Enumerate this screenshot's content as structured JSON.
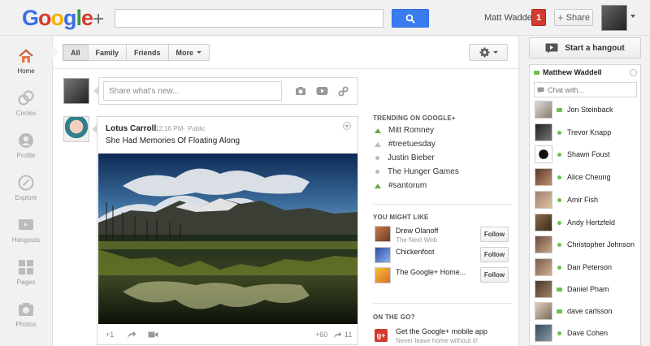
{
  "app": {
    "logo_text": "Google",
    "logo_plus": "+",
    "user_name": "Matt Waddell",
    "notification_count": "1",
    "share_label": "Share",
    "search_placeholder": "",
    "colors": {
      "accent_blue": "#3a7cf0",
      "notif_red": "#d23b2e",
      "online_green": "#6cc04a"
    }
  },
  "sidebar": {
    "items": [
      {
        "label": "Home",
        "icon": "home-icon",
        "active": true
      },
      {
        "label": "Circles",
        "icon": "circles-icon"
      },
      {
        "label": "Profile",
        "icon": "profile-icon"
      },
      {
        "label": "Explore",
        "icon": "explore-icon"
      },
      {
        "label": "Hangouts",
        "icon": "hangouts-icon"
      },
      {
        "label": "Pages",
        "icon": "pages-icon"
      },
      {
        "label": "Photos",
        "icon": "photos-icon"
      }
    ]
  },
  "stream": {
    "filters": [
      "All",
      "Family",
      "Friends",
      "More"
    ],
    "active_filter": "All",
    "share_placeholder": "Share what's new...",
    "share_tools": [
      "camera-icon",
      "video-icon",
      "link-icon"
    ]
  },
  "post": {
    "author": "Lotus Carroll",
    "time": "12:16 PM",
    "separator": "-",
    "visibility": "Public",
    "text": "She Had Memories Of Floating Along",
    "plus_one": "+1",
    "plus_count": "+60",
    "share_count": "11"
  },
  "trending": {
    "heading": "TRENDING ON GOOGLE+",
    "items": [
      {
        "label": "Mitt Romney",
        "trend": "up"
      },
      {
        "label": "#treetuesday",
        "trend": "up-grey"
      },
      {
        "label": "Justin Bieber",
        "trend": "steady"
      },
      {
        "label": "The Hunger Games",
        "trend": "steady"
      },
      {
        "label": "#santorum",
        "trend": "up"
      }
    ]
  },
  "suggestions": {
    "heading": "YOU MIGHT LIKE",
    "follow_label": "Follow",
    "items": [
      {
        "name": "Drew Olanoff",
        "sub": "The Next Web"
      },
      {
        "name": "Chickenfoot",
        "sub": ""
      },
      {
        "name": "The Google+ Home...",
        "sub": ""
      }
    ]
  },
  "mobile": {
    "heading": "ON THE GO?",
    "title": "Get the Google+ mobile app",
    "sub": "Never leave home without it!"
  },
  "chat": {
    "hangout_label": "Start a hangout",
    "me": "Matthew Waddell",
    "placeholder": "Chat with...",
    "contacts": [
      {
        "name": "Jon Steinback",
        "status": "video"
      },
      {
        "name": "Trevor Knapp",
        "status": "online"
      },
      {
        "name": "Shawn Foust",
        "status": "online"
      },
      {
        "name": "Alice Cheung",
        "status": "online"
      },
      {
        "name": "Amir Fish",
        "status": "online"
      },
      {
        "name": "Andy Hertzfeld",
        "status": "online"
      },
      {
        "name": "Christopher Johnson",
        "status": "online"
      },
      {
        "name": "Dan Peterson",
        "status": "online"
      },
      {
        "name": "Daniel Pham",
        "status": "video"
      },
      {
        "name": "dave carlsson",
        "status": "video"
      },
      {
        "name": "Dave Cohen",
        "status": "online"
      }
    ]
  }
}
